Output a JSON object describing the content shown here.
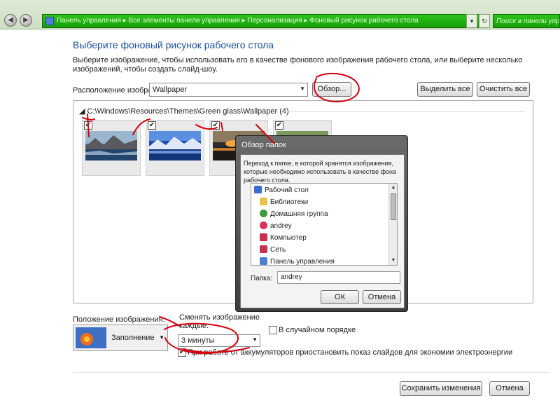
{
  "window": {
    "address_path": "Панель управления  ▸  Все элементы панели управления  ▸  Персонализация  ▸  Фоновый рисунок рабочего стола",
    "search_placeholder": "Поиск в панели управления"
  },
  "main": {
    "title": "Выберите фоновый рисунок рабочего стола",
    "description": "Выберите изображение, чтобы использовать его в качестве фонового изображения рабочего стола, или выберите несколько изображений, чтобы создать слайд-шоу.",
    "location_label": "Расположение изображения:",
    "location_value": "Wallpaper",
    "browse_label": "Обзор...",
    "select_all_label": "Выделить все",
    "clear_all_label": "Очистить все",
    "group_header": "C:\\Windows\\Resources\\Themes\\Green glass\\Wallpaper (4)",
    "thumbnails": [
      {
        "checked": true,
        "check_mark": "✔"
      },
      {
        "checked": true,
        "check_mark": "✔"
      },
      {
        "checked": true,
        "check_mark": "✔"
      },
      {
        "checked": true,
        "check_mark": "✔"
      }
    ]
  },
  "dialog": {
    "title": "Обзор папок",
    "description": "Переход к папке, в которой хранятся изображения, которые необходимо использовать в качестве фона рабочего стола.",
    "tree": [
      {
        "label": "Рабочий стол",
        "icon": "desktop-icon",
        "color": "#3a6fd0"
      },
      {
        "label": "Библиотеки",
        "icon": "libraries-icon",
        "color": "#e8c24a"
      },
      {
        "label": "Домашняя группа",
        "icon": "homegroup-icon",
        "color": "#3e9b3a"
      },
      {
        "label": "andrey",
        "icon": "user-icon",
        "color": "#d8305a"
      },
      {
        "label": "Компьютер",
        "icon": "computer-icon",
        "color": "#c8304e"
      },
      {
        "label": "Сеть",
        "icon": "network-icon",
        "color": "#c8304e"
      },
      {
        "label": "Панель управления",
        "icon": "control-panel-icon",
        "color": "#4a7fd4"
      }
    ],
    "folder_label": "Папка:",
    "folder_value": "andrey",
    "ok_label": "ОК",
    "cancel_label": "Отмена"
  },
  "options": {
    "position_label": "Положение изображения:",
    "position_value": "Заполнение",
    "change_label": "Сменять изображение каждые:",
    "interval_value": "3 минуты",
    "shuffle_label": "В случайном порядке",
    "shuffle_checked": false,
    "battery_label": "При работе от аккумуляторов приостановить показ слайдов для экономии электроэнергии",
    "battery_checked": true,
    "battery_mark": "✔"
  },
  "footer": {
    "save_label": "Сохранить изменения",
    "cancel_label": "Отмена"
  },
  "colors": {
    "title": "#1b4f9c",
    "address_bar": "#15a00a",
    "annotation_ink": "#d4000f"
  }
}
